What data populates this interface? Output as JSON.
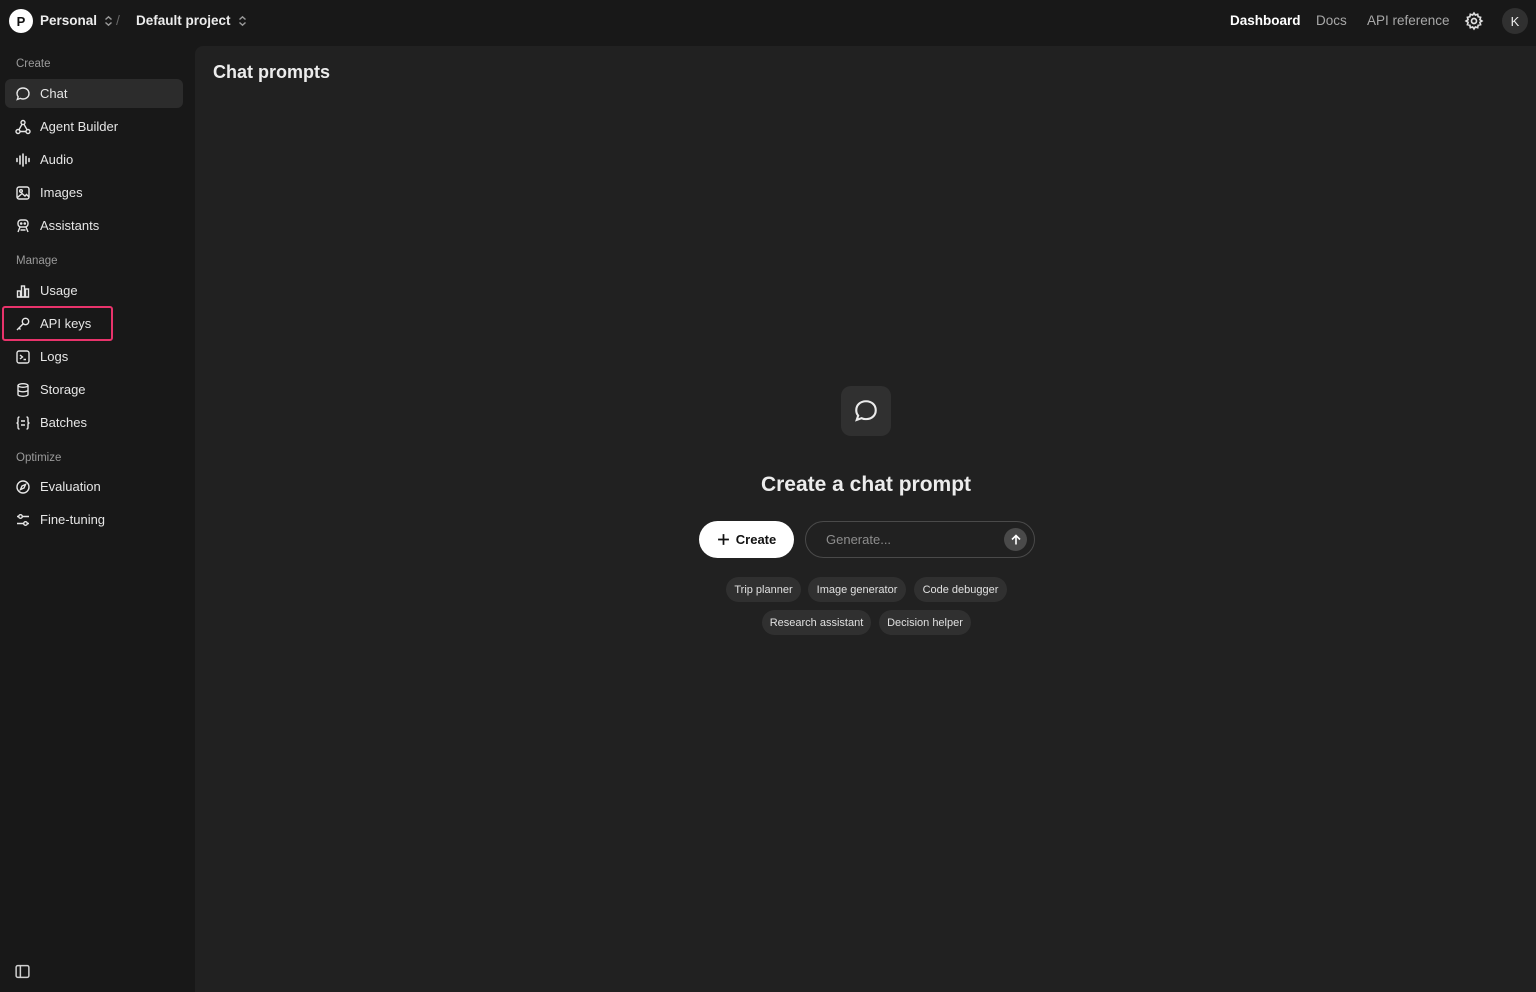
{
  "topbar": {
    "org_initial": "P",
    "org_name": "Personal",
    "project_name": "Default project",
    "separator": "/",
    "nav": [
      {
        "label": "Dashboard",
        "active": true
      },
      {
        "label": "Docs",
        "active": false
      },
      {
        "label": "API reference",
        "active": false
      }
    ],
    "user_initial": "K"
  },
  "sidebar": {
    "sections": {
      "create": "Create",
      "manage": "Manage",
      "optimize": "Optimize"
    },
    "items": [
      {
        "label": "Chat",
        "icon": "chat-bubble-icon",
        "selected": true
      },
      {
        "label": "Agent Builder",
        "icon": "agent-nodes-icon"
      },
      {
        "label": "Audio",
        "icon": "audio-wave-icon"
      },
      {
        "label": "Images",
        "icon": "image-icon"
      },
      {
        "label": "Assistants",
        "icon": "assistant-icon"
      },
      {
        "label": "Usage",
        "icon": "bar-chart-icon"
      },
      {
        "label": "API keys",
        "icon": "key-icon",
        "highlighted": true
      },
      {
        "label": "Logs",
        "icon": "terminal-icon"
      },
      {
        "label": "Storage",
        "icon": "database-icon"
      },
      {
        "label": "Batches",
        "icon": "braces-icon"
      },
      {
        "label": "Evaluation",
        "icon": "compass-icon"
      },
      {
        "label": "Fine-tuning",
        "icon": "sliders-icon"
      }
    ]
  },
  "main": {
    "title": "Chat prompts",
    "empty_state": {
      "icon": "chat-bubble-icon",
      "heading": "Create a chat prompt",
      "create_label": "Create",
      "generate_placeholder": "Generate...",
      "suggestions": [
        "Trip planner",
        "Image generator",
        "Code debugger",
        "Research assistant",
        "Decision helper"
      ]
    }
  },
  "colors": {
    "background": "#181818",
    "panel": "#212121",
    "chip": "#303030",
    "highlight": "#e8336b"
  }
}
